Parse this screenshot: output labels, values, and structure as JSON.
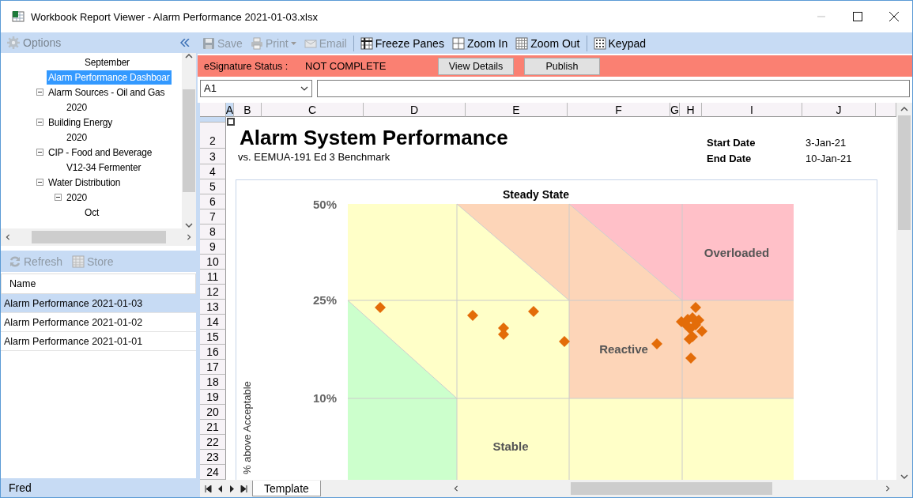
{
  "window": {
    "title": "Workbook Report Viewer - Alarm Performance 2021-01-03.xlsx"
  },
  "options_panel": {
    "title": "Options"
  },
  "tree": {
    "items": [
      {
        "children": [
          {
            "children": [
              {
                "children": [
                  {
                    "label": "September",
                    "selected": false
                  }
                ]
              }
            ]
          },
          {
            "label": "Alarm Performance Dashboar",
            "selected": true
          },
          {
            "label": "Alarm Sources - Oil and Gas",
            "selected": false,
            "expanded": true,
            "children": [
              {
                "label": "2020",
                "selected": false
              }
            ]
          },
          {
            "label": "Building Energy",
            "selected": false,
            "expanded": true,
            "children": [
              {
                "label": "2020",
                "selected": false
              }
            ]
          },
          {
            "label": "CIP - Food and Beverage",
            "selected": false,
            "expanded": true,
            "children": [
              {
                "label": "V12-34 Fermenter",
                "selected": false
              }
            ]
          },
          {
            "label": "Water Distribution",
            "selected": false,
            "expanded": true,
            "children": [
              {
                "label": "2020",
                "selected": false,
                "expanded": true,
                "children": [
                  {
                    "label": "Oct",
                    "selected": false
                  }
                ]
              }
            ]
          }
        ]
      }
    ]
  },
  "list_toolbar": [
    {
      "kind": "refresh",
      "label": "Refresh",
      "disabled": true
    },
    {
      "kind": "store",
      "label": "Store",
      "disabled": true
    }
  ],
  "list": {
    "header": "Name",
    "rows": [
      {
        "name": "Alarm Performance 2021-01-03",
        "selected": true
      },
      {
        "name": "Alarm Performance 2021-01-02",
        "selected": false
      },
      {
        "name": "Alarm Performance 2021-01-01",
        "selected": false
      }
    ]
  },
  "status_bar": {
    "user": "Fred"
  },
  "toolbar": [
    {
      "kind": "save",
      "label": "Save",
      "disabled": true
    },
    {
      "kind": "print",
      "label": "Print",
      "disabled": true
    },
    {
      "kind": "email",
      "label": "Email",
      "disabled": true
    },
    {
      "kind": "freeze",
      "label": "Freeze Panes",
      "disabled": false
    },
    {
      "kind": "zoom_in",
      "label": "Zoom In",
      "disabled": false
    },
    {
      "kind": "zoom_out",
      "label": "Zoom Out",
      "disabled": false
    },
    {
      "kind": "keypad",
      "label": "Keypad",
      "disabled": false
    }
  ],
  "esignature": {
    "label": "eSignature Status :",
    "status": "NOT COMPLETE",
    "buttons": [
      "View Details",
      "Publish"
    ]
  },
  "formula_bar": {
    "name_box": "A1"
  },
  "sheet": {
    "columns": [
      {
        "label": "A",
        "selected": true
      },
      {
        "label": "B",
        "selected": false
      },
      {
        "label": "C",
        "selected": false
      },
      {
        "label": "D",
        "selected": false
      },
      {
        "label": "E",
        "selected": false
      },
      {
        "label": "F",
        "selected": false
      },
      {
        "label": "G",
        "selected": false
      },
      {
        "label": "H",
        "selected": false
      },
      {
        "label": "I",
        "selected": false
      },
      {
        "label": "J",
        "selected": false
      }
    ],
    "rows": [
      {
        "selected": true
      },
      {
        "label": "2",
        "selected": false
      },
      {
        "label": "3",
        "selected": false
      },
      {
        "label": "4",
        "selected": false
      },
      {
        "label": "5",
        "selected": false
      },
      {
        "label": "6",
        "selected": false
      },
      {
        "label": "7",
        "selected": false
      },
      {
        "label": "8",
        "selected": false
      },
      {
        "label": "9",
        "selected": false
      },
      {
        "label": "10",
        "selected": false
      },
      {
        "label": "11",
        "selected": false
      },
      {
        "label": "12",
        "selected": false
      },
      {
        "label": "13",
        "selected": false
      },
      {
        "label": "14",
        "selected": false
      },
      {
        "label": "15",
        "selected": false
      },
      {
        "label": "16",
        "selected": false
      },
      {
        "label": "17",
        "selected": false
      },
      {
        "label": "18",
        "selected": false
      },
      {
        "label": "19",
        "selected": false
      },
      {
        "label": "20",
        "selected": false
      },
      {
        "label": "21",
        "selected": false
      },
      {
        "label": "22",
        "selected": false
      },
      {
        "label": "23",
        "selected": false
      },
      {
        "label": "24",
        "selected": false
      }
    ],
    "report": {
      "title": "Alarm System Performance",
      "subtitle": "vs. EEMUA-191 Ed 3 Benchmark",
      "start_label": "Start Date",
      "start_value": "3-Jan-21",
      "end_label": "End Date",
      "end_value": "10-Jan-21"
    },
    "chart": {
      "title": "Steady State",
      "ylabel": "% above Acceptable",
      "yticks": [
        "50%",
        "25%",
        "10%"
      ],
      "zones": [
        "Overloaded",
        "Reactive",
        "Stable"
      ]
    },
    "tabs": [
      {
        "label": "Template",
        "selected": true
      }
    ]
  }
}
